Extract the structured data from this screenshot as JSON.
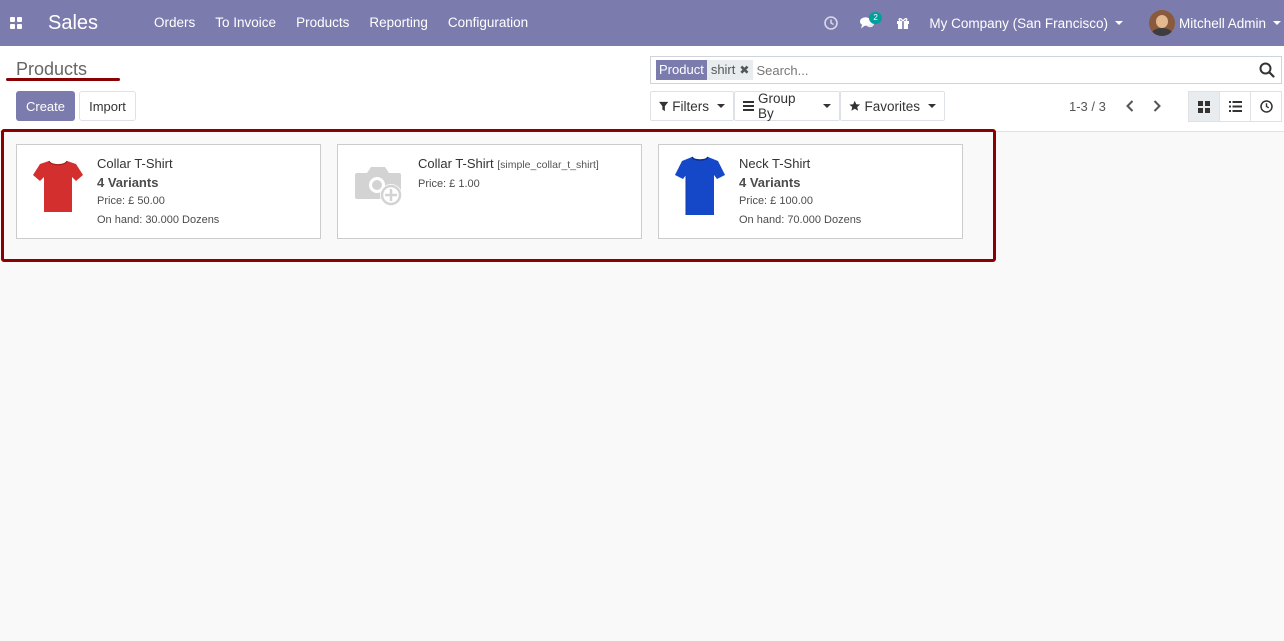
{
  "navbar": {
    "app_name": "Sales",
    "menu": [
      "Orders",
      "To Invoice",
      "Products",
      "Reporting",
      "Configuration"
    ],
    "chat_badge": "2",
    "company": "My Company (San Francisco)",
    "user": "Mitchell Admin"
  },
  "control_panel": {
    "breadcrumb": "Products",
    "create_label": "Create",
    "import_label": "Import",
    "search": {
      "facet_category": "Product",
      "facet_value": "shirt",
      "facet_remove": "✖",
      "placeholder": "Search..."
    },
    "filters_label": "Filters",
    "groupby_label": "Group By",
    "favorites_label": "Favorites",
    "pager": "1-3 / 3",
    "active_view": "kanban"
  },
  "products": [
    {
      "name": "Collar T-Shirt",
      "ref": "",
      "variants": "4 Variants",
      "price": "Price: £ 50.00",
      "on_hand": "On hand: 30.000 Dozens",
      "image": "red-tshirt",
      "color": "#d32f2f"
    },
    {
      "name": "Collar T-Shirt",
      "ref": "[simple_collar_t_shirt]",
      "variants": "",
      "price": "Price: £ 1.00",
      "on_hand": "",
      "image": "camera-placeholder-icon"
    },
    {
      "name": "Neck T-Shirt",
      "ref": "",
      "variants": "4 Variants",
      "price": "Price: £ 100.00",
      "on_hand": "On hand: 70.000 Dozens",
      "image": "blue-tshirt",
      "color": "#1548c9"
    }
  ],
  "colors": {
    "brand": "#7c7bad",
    "highlight": "#8b0000",
    "badge": "#00a09d"
  }
}
